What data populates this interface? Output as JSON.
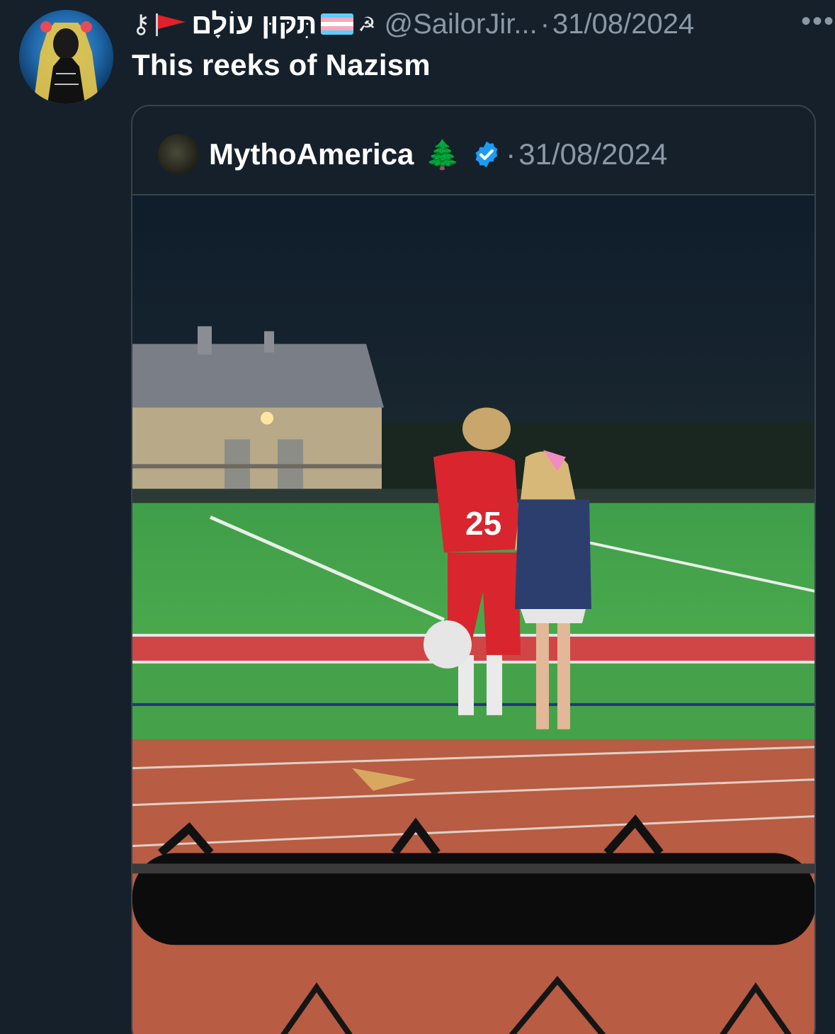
{
  "tweet": {
    "display_name_symbol": "⚷",
    "display_name_text": "תִּקּוּן עוֹלָם",
    "display_name_suffix": "☭",
    "handle": "@SailorJir...",
    "dot": "·",
    "date": "31/08/2024",
    "more_label": "•••",
    "text": "This reeks of Nazism"
  },
  "quote": {
    "name": "MythoAmerica",
    "tree_emoji": "🌲",
    "dot": "·",
    "date": "31/08/2024"
  },
  "icons": {
    "more": "more-options-icon",
    "verified": "verified-badge-icon",
    "flag": "red-flag-icon",
    "trans_flag": "transgender-flag-icon"
  },
  "colors": {
    "background": "#15202b",
    "muted_text": "#8b98a5",
    "verified_blue": "#1d9bf0",
    "border": "#38444d"
  }
}
